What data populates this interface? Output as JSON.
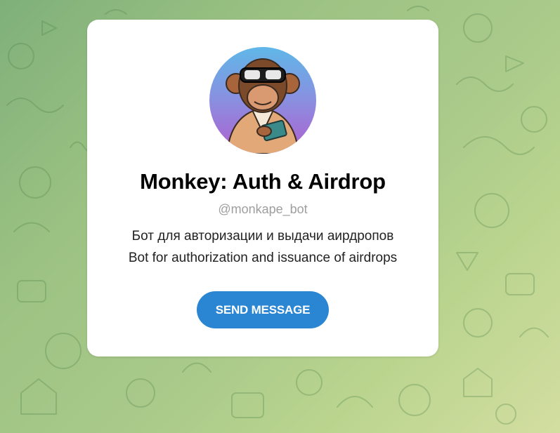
{
  "bot": {
    "name": "Monkey: Auth & Airdrop",
    "username": "@monkape_bot",
    "description_ru": "Бот для авторизации и выдачи аирдропов",
    "description_en": "Bot for authorization and issuance of airdrops"
  },
  "actions": {
    "send_message_label": "SEND MESSAGE"
  },
  "colors": {
    "button": "#2a86d3",
    "background_start": "#7fb07a",
    "background_end": "#d3dea0",
    "username_text": "#9e9e9e"
  },
  "icons": {
    "avatar": "monkey-ape-avatar"
  }
}
